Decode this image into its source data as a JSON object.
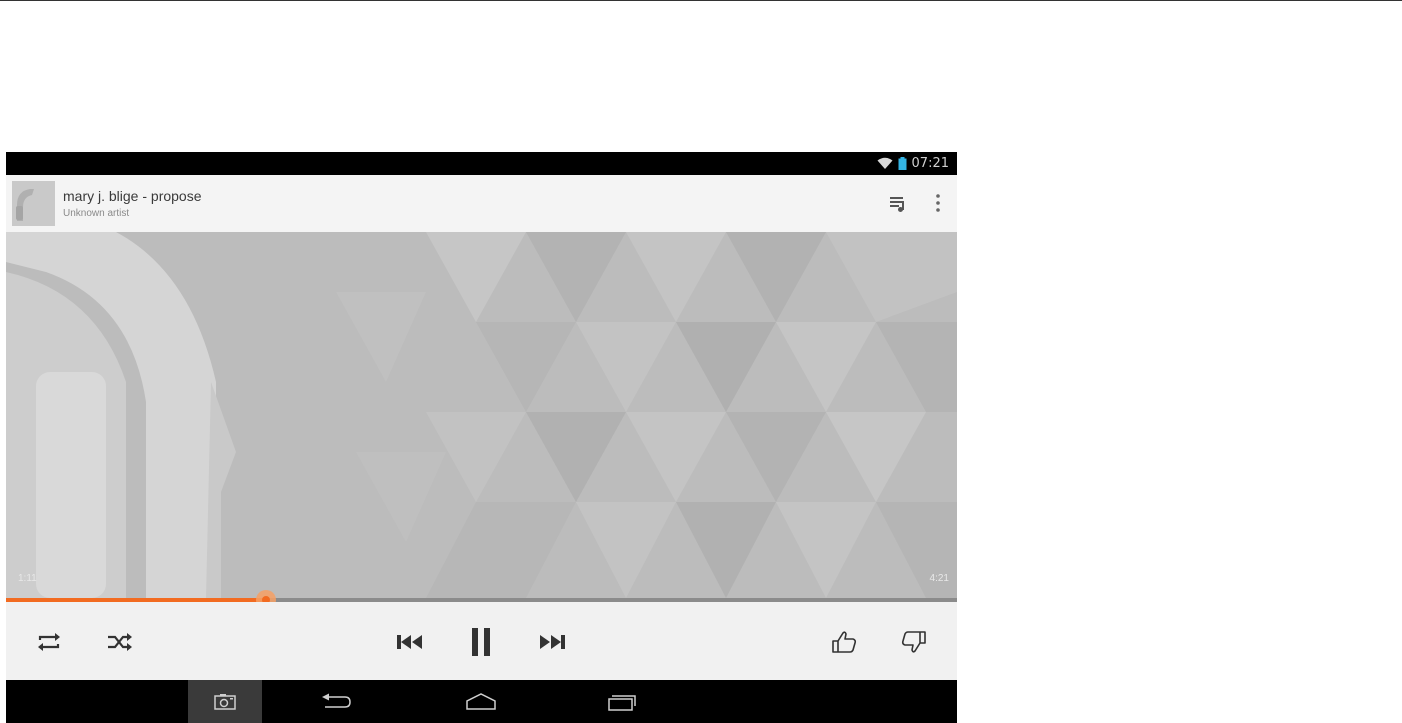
{
  "status_bar": {
    "time": "07:21",
    "wifi_icon": "wifi-icon",
    "battery_icon": "battery-icon",
    "battery_color": "#33b5e5"
  },
  "track": {
    "title": "mary j. blige - propose",
    "artist": "Unknown artist"
  },
  "header_actions": {
    "queue_icon": "queue-icon",
    "menu_icon": "overflow-menu-icon"
  },
  "playback": {
    "current_time": "1:11",
    "total_time": "4:21",
    "progress_fraction": 0.273,
    "accent_color": "#f26b21"
  },
  "controls": {
    "repeat": "repeat-icon",
    "shuffle": "shuffle-icon",
    "previous": "previous-icon",
    "pause": "pause-icon",
    "next": "next-icon",
    "thumbs_up": "thumbs-up-icon",
    "thumbs_down": "thumbs-down-icon"
  },
  "nav_bar": {
    "screenshot": "screenshot-icon",
    "back": "back-icon",
    "home": "home-icon",
    "recents": "recents-icon"
  }
}
